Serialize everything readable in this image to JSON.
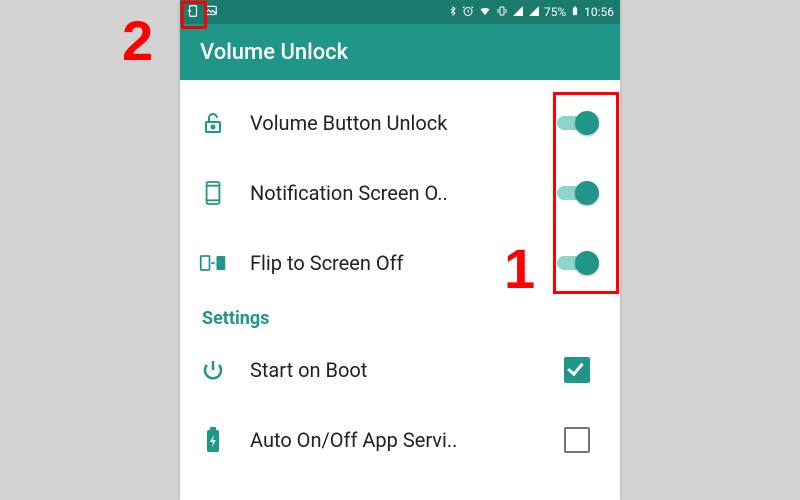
{
  "status": {
    "battery_pct": "75%",
    "time": "10:56"
  },
  "app": {
    "title": "Volume Unlock"
  },
  "rows": [
    {
      "icon": "unlock-icon",
      "label": "Volume Button Unlock",
      "control": "toggle",
      "on": true
    },
    {
      "icon": "phone-outline-icon",
      "label": "Notification Screen O..",
      "control": "toggle",
      "on": true
    },
    {
      "icon": "flip-icon",
      "label": "Flip to Screen Off",
      "control": "toggle",
      "on": true
    }
  ],
  "section_header": "Settings",
  "settings_rows": [
    {
      "icon": "power-icon",
      "label": "Start on Boot",
      "control": "checkbox",
      "checked": true
    },
    {
      "icon": "battery-icon",
      "label": "Auto On/Off App Servi..",
      "control": "checkbox",
      "checked": false
    }
  ],
  "annotations": {
    "marker1": "1",
    "marker2": "2"
  },
  "colors": {
    "accent": "#1f9688",
    "status_bg": "#1a7a6e"
  }
}
